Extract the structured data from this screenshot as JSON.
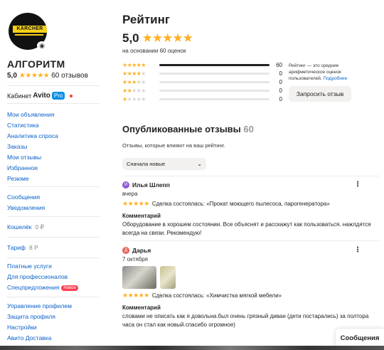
{
  "sidebar": {
    "avatar_brand": "KÄRCHER",
    "shop_name": "АЛГОРИТМ",
    "rating": "5,0",
    "stars": "★★★★★",
    "reviews_count": "60 отзывов",
    "cabinet": {
      "label": "Кабинет",
      "avito": "Avito",
      "pro": "Pro"
    },
    "menu1": [
      "Мои объявления",
      "Статистика",
      "Аналитика спроса",
      "Заказы",
      "Мои отзывы",
      "Избранное",
      "Резюме"
    ],
    "menu2": [
      "Сообщения",
      "Уведомления"
    ],
    "wallet": {
      "label": "Кошелёк",
      "value": "0 ₽"
    },
    "tariff": {
      "label": "Тариф",
      "value": "8 Р"
    },
    "menu3": [
      "Платные услуги",
      "Для профессионалов",
      "Спецпредложения"
    ],
    "new_badge": "Новое",
    "menu4": [
      "Управление профилем",
      "Защита профиля",
      "Настройки",
      "Авито Доставка"
    ]
  },
  "main": {
    "title": "Рейтинг",
    "rating": "5,0",
    "stars": "★★★★★",
    "basis": "на основании 60 оценок",
    "distribution": [
      {
        "stars": 5,
        "fraction": 1.0,
        "count": "60"
      },
      {
        "stars": 4,
        "fraction": 0,
        "count": "0"
      },
      {
        "stars": 3,
        "fraction": 0,
        "count": "0"
      },
      {
        "stars": 2,
        "fraction": 0,
        "count": "0"
      },
      {
        "stars": 1,
        "fraction": 0,
        "count": "0"
      }
    ],
    "note": "Рейтинг — это среднее арифметическое оценок пользователей.",
    "note_more": "Подробнее",
    "ask_button": "Запросить отзыв",
    "published_title": "Опубликованные отзывы",
    "published_count": "60",
    "published_sub": "Отзывы, которые влияют на ваш рейтинг.",
    "sort_value": "Сначала новые",
    "reviews": [
      {
        "initial": "И",
        "avatar_color": "#8e5bd6",
        "author": "Илья Шлепп",
        "date": "вчера",
        "stars": "★★★★★",
        "deal": "Сделка состоялась: «Прокат моющего пылесоса, парогенератора»",
        "label": "Комментарий",
        "text": "Оборудование в хорошем состоянии. Все объяснят и расскажут как пользоваться. нажлдятся всегда на связи. Рекомендую!"
      },
      {
        "initial": "Д",
        "avatar_color": "#e8615a",
        "author": "Дарья",
        "date": "7 октября",
        "stars": "★★★★★",
        "deal": "Сделка состоялась: «Химчистка мягкой мебели»",
        "label": "Комментарий",
        "text": "словами не описать как я довольна.был очень грязный диван (дети постарались) за полтора часа он стал как новый.спасибо огромное)"
      }
    ]
  },
  "messages_button": "Сообщения"
}
